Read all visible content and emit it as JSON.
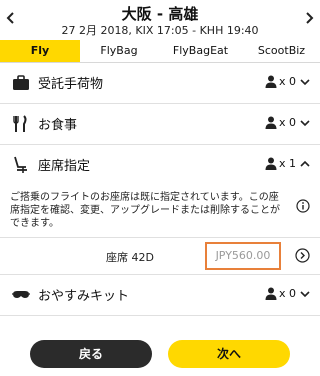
{
  "header": {
    "route": "大阪 - 高雄",
    "date_line": "27 2月 2018, KIX 17:05 - KHH 19:40"
  },
  "tabs": [
    {
      "label": "Fly",
      "active": true
    },
    {
      "label": "FlyBag",
      "active": false
    },
    {
      "label": "FlyBagEat",
      "active": false
    },
    {
      "label": "ScootBiz",
      "active": false
    }
  ],
  "sections": {
    "baggage": {
      "label": "受託手荷物",
      "count": "x 0"
    },
    "meal": {
      "label": "お食事",
      "count": "x 0"
    },
    "seat": {
      "label": "座席指定",
      "count": "x 1"
    },
    "rest_kit": {
      "label": "おやすみキット",
      "count": "x 0"
    }
  },
  "seat_info": {
    "description": "ご搭乗のフライトのお座席は既に指定されています。この座席指定を確認、変更、アップグレードまたは削除することができます。",
    "seat_label": "座席 42D",
    "price": "JPY560.00"
  },
  "buttons": {
    "back": "戻る",
    "next": "次へ"
  },
  "colors": {
    "accent": "#ffd800",
    "highlight_border": "#e8803a",
    "dark_button": "#2b2b2b"
  }
}
